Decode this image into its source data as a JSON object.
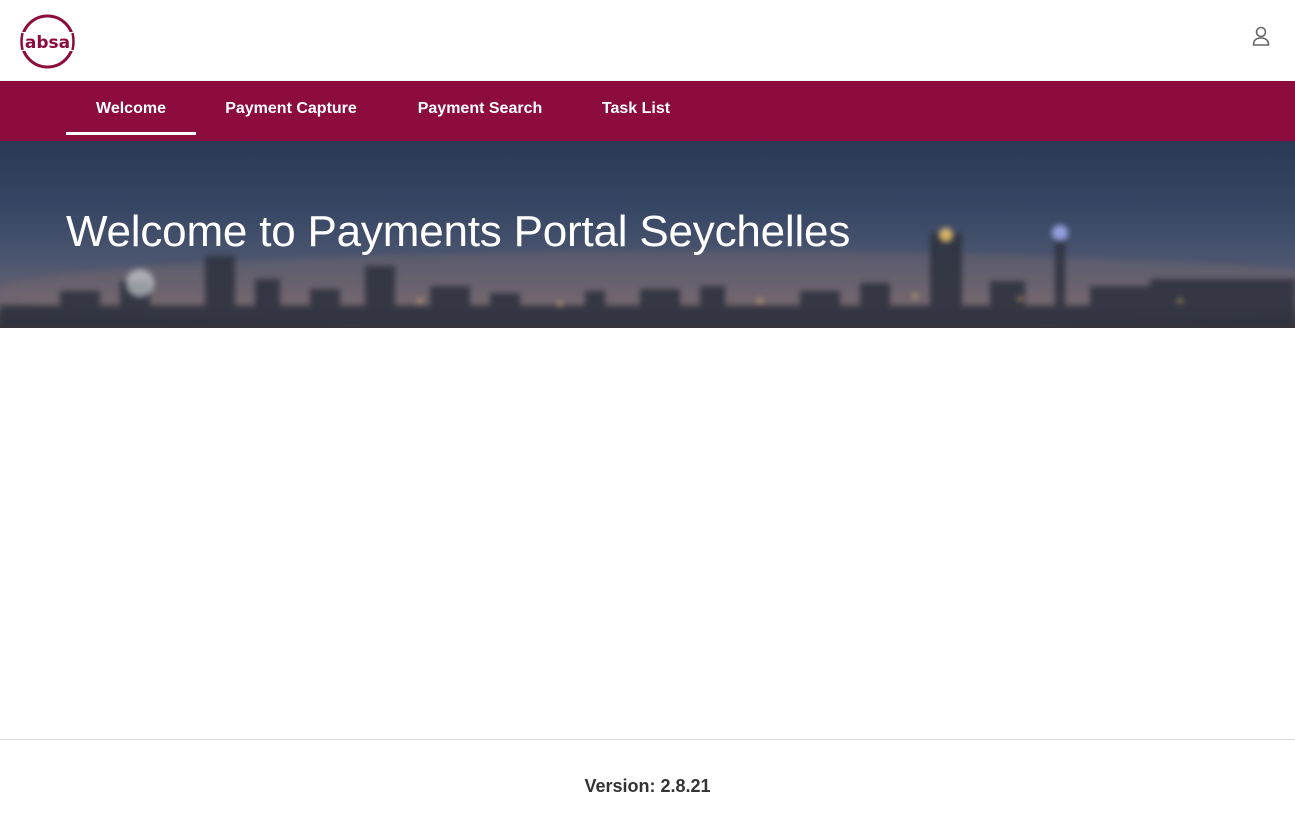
{
  "brand": {
    "logo_text": "absa",
    "brand_color": "#8b0c3d"
  },
  "header": {
    "user_icon": "user-icon"
  },
  "nav": {
    "tabs": [
      {
        "label": "Welcome",
        "active": true
      },
      {
        "label": "Payment Capture",
        "active": false
      },
      {
        "label": "Payment Search",
        "active": false
      },
      {
        "label": "Task List",
        "active": false
      }
    ]
  },
  "hero": {
    "title": "Welcome to Payments Portal Seychelles"
  },
  "footer": {
    "version": "Version: 2.8.21"
  }
}
